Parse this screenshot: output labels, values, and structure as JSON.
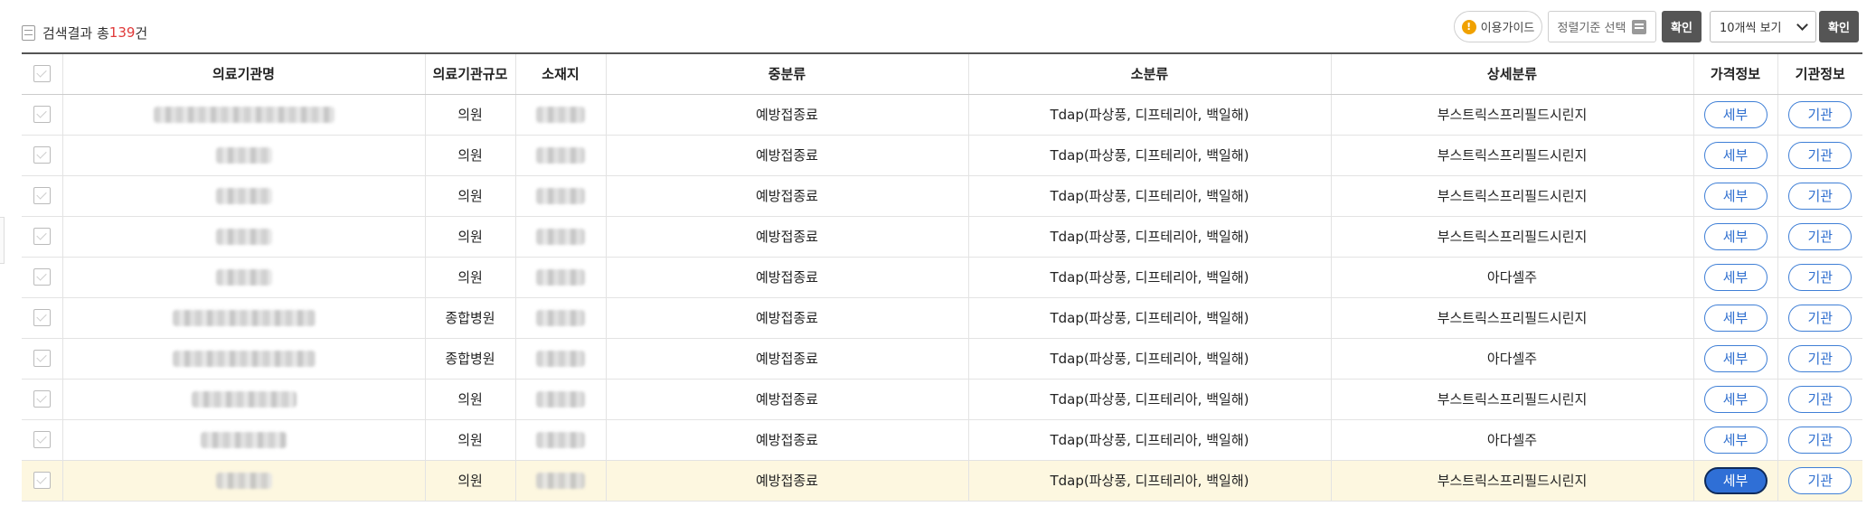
{
  "header": {
    "result_prefix": "검색결과 총",
    "result_count": "139",
    "result_suffix": "건",
    "guide_label": "이용가이드",
    "sort_placeholder": "정렬기준 선택",
    "confirm_label": "확인",
    "page_size_label": "10개씩 보기",
    "confirm2_label": "확인"
  },
  "table": {
    "columns": [
      "의료기관명",
      "의료기관규모",
      "소재지",
      "중분류",
      "소분류",
      "상세분류",
      "가격정보",
      "기관정보"
    ],
    "detail_label": "세부",
    "inst_label": "기관",
    "rows": [
      {
        "size": "의원",
        "mid": "예방접종료",
        "sub": "Tdap(파상풍, 디프테리아, 백일해)",
        "detail": "부스트릭스프리필드시린지"
      },
      {
        "size": "의원",
        "mid": "예방접종료",
        "sub": "Tdap(파상풍, 디프테리아, 백일해)",
        "detail": "부스트릭스프리필드시린지"
      },
      {
        "size": "의원",
        "mid": "예방접종료",
        "sub": "Tdap(파상풍, 디프테리아, 백일해)",
        "detail": "부스트릭스프리필드시린지"
      },
      {
        "size": "의원",
        "mid": "예방접종료",
        "sub": "Tdap(파상풍, 디프테리아, 백일해)",
        "detail": "부스트릭스프리필드시린지"
      },
      {
        "size": "의원",
        "mid": "예방접종료",
        "sub": "Tdap(파상풍, 디프테리아, 백일해)",
        "detail": "아다셀주"
      },
      {
        "size": "종합병원",
        "mid": "예방접종료",
        "sub": "Tdap(파상풍, 디프테리아, 백일해)",
        "detail": "부스트릭스프리필드시린지"
      },
      {
        "size": "종합병원",
        "mid": "예방접종료",
        "sub": "Tdap(파상풍, 디프테리아, 백일해)",
        "detail": "아다셀주"
      },
      {
        "size": "의원",
        "mid": "예방접종료",
        "sub": "Tdap(파상풍, 디프테리아, 백일해)",
        "detail": "부스트릭스프리필드시린지"
      },
      {
        "size": "의원",
        "mid": "예방접종료",
        "sub": "Tdap(파상풍, 디프테리아, 백일해)",
        "detail": "아다셀주"
      },
      {
        "size": "의원",
        "mid": "예방접종료",
        "sub": "Tdap(파상풍, 디프테리아, 백일해)",
        "detail": "부스트릭스프리필드시린지"
      }
    ],
    "highlight_row": 9
  }
}
